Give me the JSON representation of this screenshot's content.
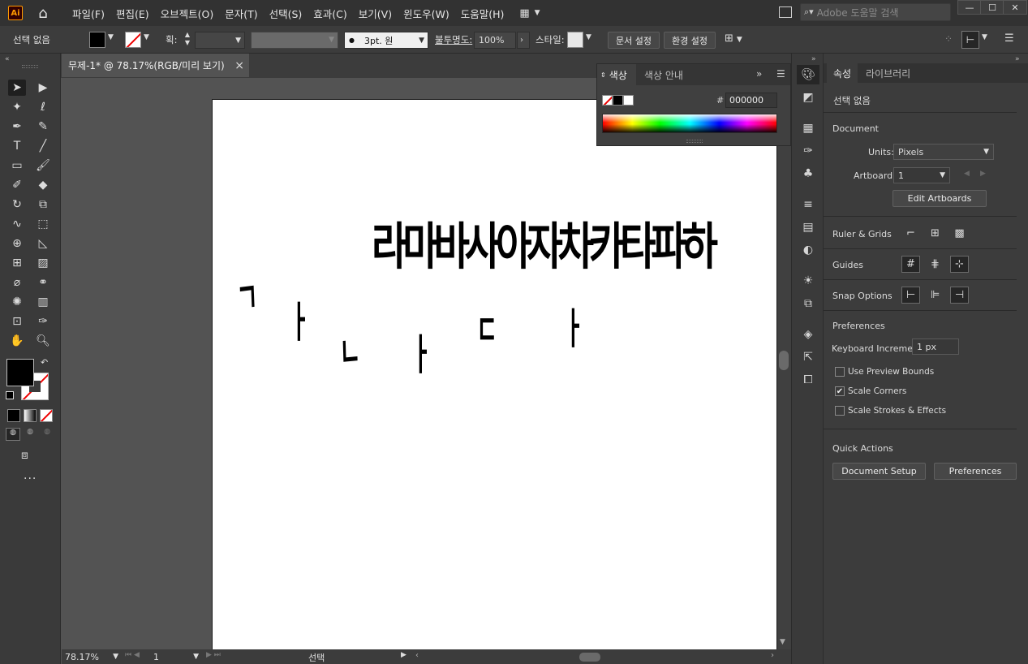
{
  "app": {
    "logo": "Ai"
  },
  "menu": [
    "파일(F)",
    "편집(E)",
    "오브젝트(O)",
    "문자(T)",
    "선택(S)",
    "효과(C)",
    "보기(V)",
    "윈도우(W)",
    "도움말(H)"
  ],
  "search": {
    "placeholder": "Adobe 도움말 검색"
  },
  "control": {
    "selection": "선택 없음",
    "stroke_label": "획:",
    "brush": "3pt. 원",
    "opacity_label": "불투명도:",
    "opacity": "100%",
    "style_label": "스타일:",
    "doc_setup": "문서 설정",
    "prefs": "환경 설정"
  },
  "document": {
    "tab_title": "무제-1* @ 78.17%(RGB/미리 보기)",
    "close": "×"
  },
  "artboard": {
    "headline": "라마바사아자차카타파하",
    "letters": [
      "ㄱ",
      "ㅏ",
      "ㄴ",
      "ㅏ",
      "ㄷ",
      "ㅏ"
    ]
  },
  "color_panel": {
    "tabs": [
      "색상",
      "색상 안내"
    ],
    "hex_label": "#",
    "hex": "000000"
  },
  "status": {
    "zoom": "78.17%",
    "artboard_num": "1",
    "tool": "선택"
  },
  "properties": {
    "tabs": [
      "속성",
      "라이브러리"
    ],
    "selection": "선택 없음",
    "document_header": "Document",
    "units_label": "Units:",
    "units": "Pixels",
    "artboard_label": "Artboard:",
    "artboard": "1",
    "edit_artboards": "Edit Artboards",
    "ruler_grids": "Ruler & Grids",
    "guides": "Guides",
    "snap": "Snap Options",
    "preferences_header": "Preferences",
    "keyboard_label": "Keyboard Increment:",
    "keyboard_value": "1 px",
    "use_preview_bounds": "Use Preview Bounds",
    "scale_corners": "Scale Corners",
    "scale_strokes": "Scale Strokes & Effects",
    "scale_corners_checked": true,
    "quick_actions": "Quick Actions",
    "doc_setup_btn": "Document Setup",
    "preferences_btn": "Preferences"
  },
  "colors": {
    "accent": "#ff9a00",
    "bg": "#535353",
    "panel": "#3c3c3c"
  }
}
